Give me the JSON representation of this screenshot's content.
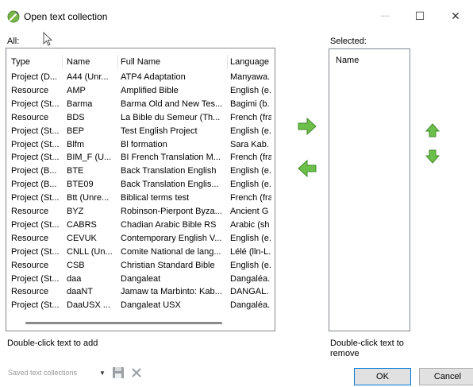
{
  "window": {
    "title": "Open text collection",
    "minimize": "—",
    "maximize": "☐",
    "close": "✕"
  },
  "left": {
    "label": "All:",
    "columns": [
      "Type",
      "Name",
      "Full Name",
      "Language"
    ],
    "rows": [
      [
        "Project (D...",
        "A44 (Unr...",
        "ATP4 Adaptation",
        "Manyawa."
      ],
      [
        "Resource",
        "AMP",
        "Amplified Bible",
        "English (e."
      ],
      [
        "Project (St...",
        "Barma",
        "Barma Old and New Tes...",
        "Bagimi (b."
      ],
      [
        "Resource",
        "BDS",
        "La Bible du Semeur (Th...",
        "French (fra"
      ],
      [
        "Project (St...",
        "BEP",
        "Test English Project",
        "English (e."
      ],
      [
        "Project (St...",
        "Blfm",
        "Bl formation",
        "Sara Kab."
      ],
      [
        "Project (St...",
        "BIM_F (U...",
        "BI French Translation M...",
        "French (fra"
      ],
      [
        "Project (B...",
        "BTE",
        "Back Translation English",
        "English (e."
      ],
      [
        "Project (B...",
        "BTE09",
        "Back Translation Englis...",
        "English (e."
      ],
      [
        "Project (St...",
        "Btt (Unre...",
        "Biblical terms test",
        "French (fra"
      ],
      [
        "Resource",
        "BYZ",
        "Robinson-Pierpont Byza...",
        "Ancient G"
      ],
      [
        "Project (St...",
        "CABRS",
        "Chadian Arabic Bible RS",
        "Arabic (sh"
      ],
      [
        "Resource",
        "CEVUK",
        "Contemporary English V...",
        "English (e."
      ],
      [
        "Project (St...",
        "CNLL (Un...",
        "Comite National de lang...",
        "Lélé (lln-L."
      ],
      [
        "Resource",
        "CSB",
        "Christian Standard Bible",
        "English (e."
      ],
      [
        "Project (St...",
        "daa",
        "Dangaleat",
        "Dangaléa."
      ],
      [
        "Resource",
        "daaNT",
        "Jamaw ta Marbinto: Kab...",
        "DANGAL."
      ],
      [
        "Project (St...",
        "DaaUSX ...",
        "Dangaleat USX",
        "Dangaléa."
      ]
    ],
    "hint": "Double-click text to add"
  },
  "right": {
    "label": "Selected:",
    "column": "Name",
    "hint_line1": "Double-click text to",
    "hint_line2": "remove"
  },
  "icons": {
    "add": "arrow-right-icon",
    "remove": "arrow-left-icon",
    "up": "arrow-up-icon",
    "down": "arrow-down-icon",
    "app": "paratext-icon",
    "save": "save-icon",
    "delete": "delete-icon"
  },
  "colors": {
    "arrow_green": "#5cb85c",
    "accent": "#0078d7"
  },
  "bottom": {
    "saved_placeholder": "Saved text collections",
    "ok": "OK",
    "cancel": "Cancel"
  }
}
